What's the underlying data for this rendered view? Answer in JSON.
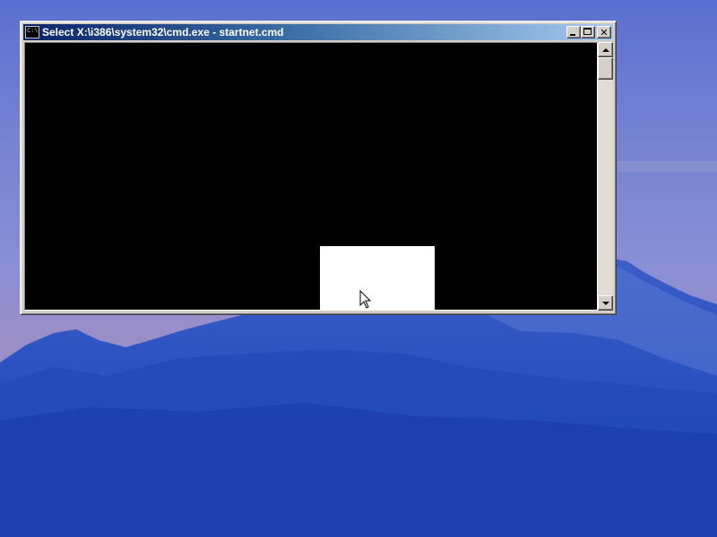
{
  "window": {
    "title": "Select X:\\i386\\system32\\cmd.exe - startnet.cmd",
    "icon": "cmd-console-icon",
    "icon_text": "C:\\",
    "buttons": [
      "minimize-icon",
      "maximize-icon",
      "close-icon"
    ],
    "close_glyph": "✕"
  },
  "console": {
    "background": "#000000",
    "selection_color": "#ffffff"
  },
  "scrollbar": {
    "orientation": "vertical",
    "up_icon": "arrow-up-icon",
    "down_icon": "arrow-down-icon"
  },
  "desktop": {
    "wallpaper": "mountain-at-dusk",
    "sky_color": "#7080d0",
    "mountain_color": "#2148b8"
  },
  "pointer": {
    "icon": "arrow-cursor-icon"
  }
}
